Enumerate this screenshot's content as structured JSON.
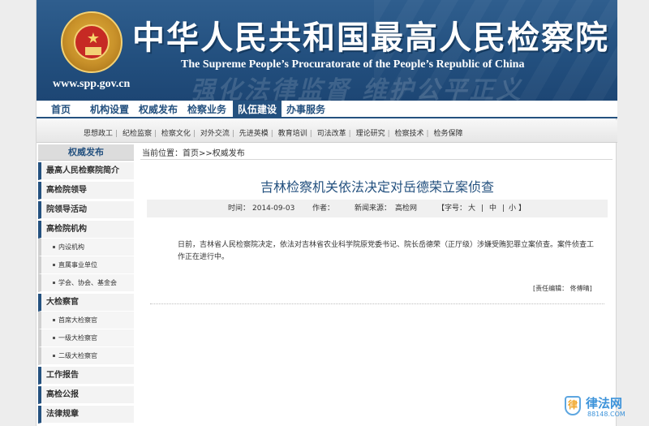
{
  "header": {
    "title_cn": "中华人民共和国最高人民检察院",
    "title_en": "The Supreme People’s Procuratorate of the People’s Republic of China",
    "site_url": "www.spp.gov.cn",
    "slogan": "强化法律监督 维护公平正义"
  },
  "main_nav": {
    "items": [
      "首页",
      "机构设置",
      "权威发布",
      "检察业务",
      "队伍建设",
      "办事服务"
    ],
    "active": "队伍建设"
  },
  "sub_nav": {
    "items": [
      "思想政工",
      "纪检监察",
      "检察文化",
      "对外交流",
      "先进英模",
      "教育培训",
      "司法改革",
      "理论研究",
      "检察技术",
      "检务保障"
    ]
  },
  "sidebar": {
    "heading": "权威发布",
    "groups": [
      {
        "label": "最高人民检察院简介",
        "subs": []
      },
      {
        "label": "高检院领导",
        "subs": []
      },
      {
        "label": "院领导活动",
        "subs": []
      },
      {
        "label": "高检院机构",
        "subs": [
          "内设机构",
          "直属事业单位",
          "学会、协会、基金会"
        ]
      },
      {
        "label": "大检察官",
        "subs": [
          "首席大检察官",
          "一级大检察官",
          "二级大检察官"
        ]
      },
      {
        "label": "工作报告",
        "subs": []
      },
      {
        "label": "高检公报",
        "subs": []
      },
      {
        "label": "法律规章",
        "subs": []
      }
    ]
  },
  "content": {
    "breadcrumb": "当前位置：首页>>权威发布",
    "title": "吉林检察机关依法决定对岳德荣立案侦查",
    "meta": {
      "time_label": "时间：",
      "time": "2014-09-03",
      "author_label": "作者：",
      "source_label": "新闻来源：",
      "source": "高检网",
      "font_size_label": "【字号：",
      "font_large": "大",
      "font_medium": "中",
      "font_small": "小",
      "font_sep": "|",
      "font_end": "】"
    },
    "body": "日前，吉林省人民检察院决定，依法对吉林省农业科学院原党委书记、院长岳德荣（正厅级）涉嫌受贿犯罪立案侦查。案件侦查工作正在进行中。",
    "editor": "[责任编辑：  佟傅晴]"
  },
  "watermark": {
    "name": "律法网",
    "url": "88148.COM",
    "shield_char": "律"
  }
}
